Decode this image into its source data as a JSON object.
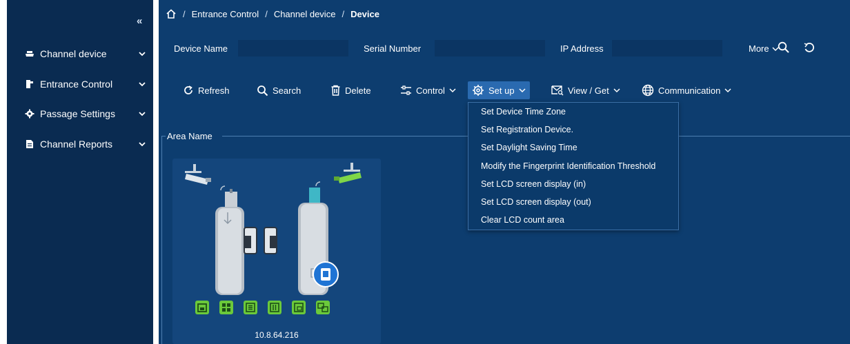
{
  "sidebar": {
    "collapse_icon": "«",
    "items": [
      {
        "label": "Channel device",
        "icon": "device-icon"
      },
      {
        "label": "Entrance Control",
        "icon": "turnstile-icon"
      },
      {
        "label": "Passage Settings",
        "icon": "gear-icon"
      },
      {
        "label": "Channel Reports",
        "icon": "report-icon"
      }
    ]
  },
  "breadcrumb": {
    "sep": "/",
    "items": [
      "Entrance Control",
      "Channel device",
      "Device"
    ]
  },
  "filters": {
    "device_name_label": "Device Name",
    "device_name_value": "",
    "serial_number_label": "Serial Number",
    "serial_number_value": "",
    "ip_address_label": "IP Address",
    "ip_address_value": "",
    "more_label": "More"
  },
  "toolbar": {
    "refresh": "Refresh",
    "search": "Search",
    "delete": "Delete",
    "control": "Control",
    "setup": "Set up",
    "view_get": "View / Get",
    "communication": "Communication"
  },
  "area": {
    "label": "Area Name"
  },
  "device": {
    "ip": "10.8.64.216"
  },
  "setup_menu": {
    "items": [
      "Set Device Time Zone",
      "Set Registration Device.",
      "Set Daylight Saving Time",
      "Modify the Fingerprint Identification Threshold",
      "Set LCD screen display (in)",
      "Set LCD screen display (out)",
      "Clear LCD count area"
    ]
  },
  "colors": {
    "sidebar_bg": "#0a2b51",
    "main_bg": "#0d3d6f",
    "active_button": "#2a6ab0",
    "action_green": "#6bc93a"
  }
}
